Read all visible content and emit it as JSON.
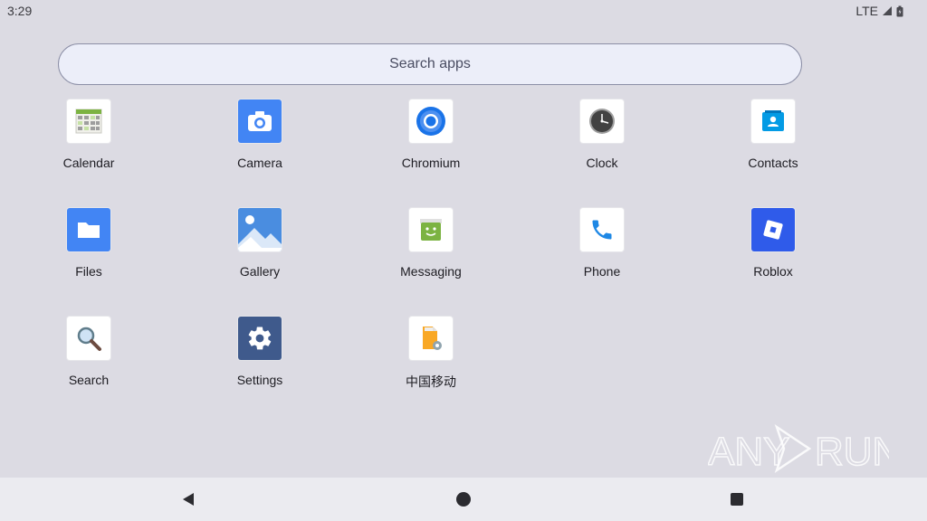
{
  "status": {
    "time": "3:29",
    "network": "LTE"
  },
  "search": {
    "placeholder": "Search apps"
  },
  "apps": [
    {
      "label": "Calendar",
      "icon": "calendar-icon"
    },
    {
      "label": "Camera",
      "icon": "camera-icon"
    },
    {
      "label": "Chromium",
      "icon": "chromium-icon"
    },
    {
      "label": "Clock",
      "icon": "clock-icon"
    },
    {
      "label": "Contacts",
      "icon": "contacts-icon"
    },
    {
      "label": "Files",
      "icon": "folder-icon"
    },
    {
      "label": "Gallery",
      "icon": "gallery-icon"
    },
    {
      "label": "Messaging",
      "icon": "messaging-icon"
    },
    {
      "label": "Phone",
      "icon": "phone-icon"
    },
    {
      "label": "Roblox",
      "icon": "roblox-icon"
    },
    {
      "label": "Search",
      "icon": "magnifier-icon"
    },
    {
      "label": "Settings",
      "icon": "gear-icon"
    },
    {
      "label": "中国移动",
      "icon": "sim-toolkit-icon"
    }
  ],
  "watermark": {
    "text": "ANY RUN"
  },
  "colors": {
    "background": "#dcdbe3",
    "search_fill": "#eceef9",
    "nav_bar": "#ebebf0"
  }
}
